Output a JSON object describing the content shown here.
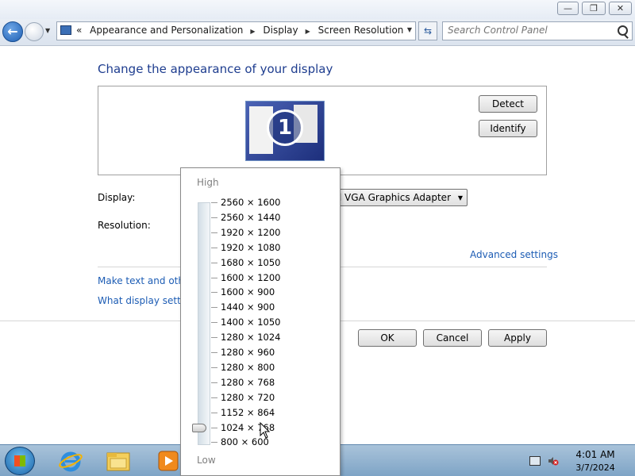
{
  "window": {
    "buttons": {
      "minimize": "—",
      "maximize": "❐",
      "close": "✕"
    }
  },
  "navigation": {
    "crumb_prefix": "«",
    "breadcrumb": [
      "Appearance and Personalization",
      "Display",
      "Screen Resolution"
    ],
    "search_placeholder": "Search Control Panel"
  },
  "main": {
    "title": "Change the appearance of your display",
    "monitor_number": "1",
    "detect_label": "Detect",
    "identify_label": "Identify",
    "display_label": "Display:",
    "display_value": "ard VGA Graphics Adapter",
    "resolution_label": "Resolution:",
    "advanced_link": "Advanced settings",
    "link_text_size": "Make text and other",
    "link_display_settings": "What display setting",
    "ok_label": "OK",
    "cancel_label": "Cancel",
    "apply_label": "Apply"
  },
  "resolution_popup": {
    "high_label": "High",
    "low_label": "Low",
    "options": [
      "2560 × 1600",
      "2560 × 1440",
      "1920 × 1200",
      "1920 × 1080",
      "1680 × 1050",
      "1600 × 1200",
      "1600 × 900",
      "1440 × 900",
      "1400 × 1050",
      "1280 × 1024",
      "1280 × 960",
      "1280 × 800",
      "1280 × 768",
      "1280 × 720",
      "1152 × 864",
      "1024 × 768",
      "800 × 600"
    ],
    "selected_index": 15
  },
  "taskbar": {
    "apps": [
      "internet-explorer-icon",
      "windows-explorer-icon",
      "media-player-icon"
    ],
    "clock_time": "4:01 AM",
    "clock_date": "3/7/2024"
  }
}
